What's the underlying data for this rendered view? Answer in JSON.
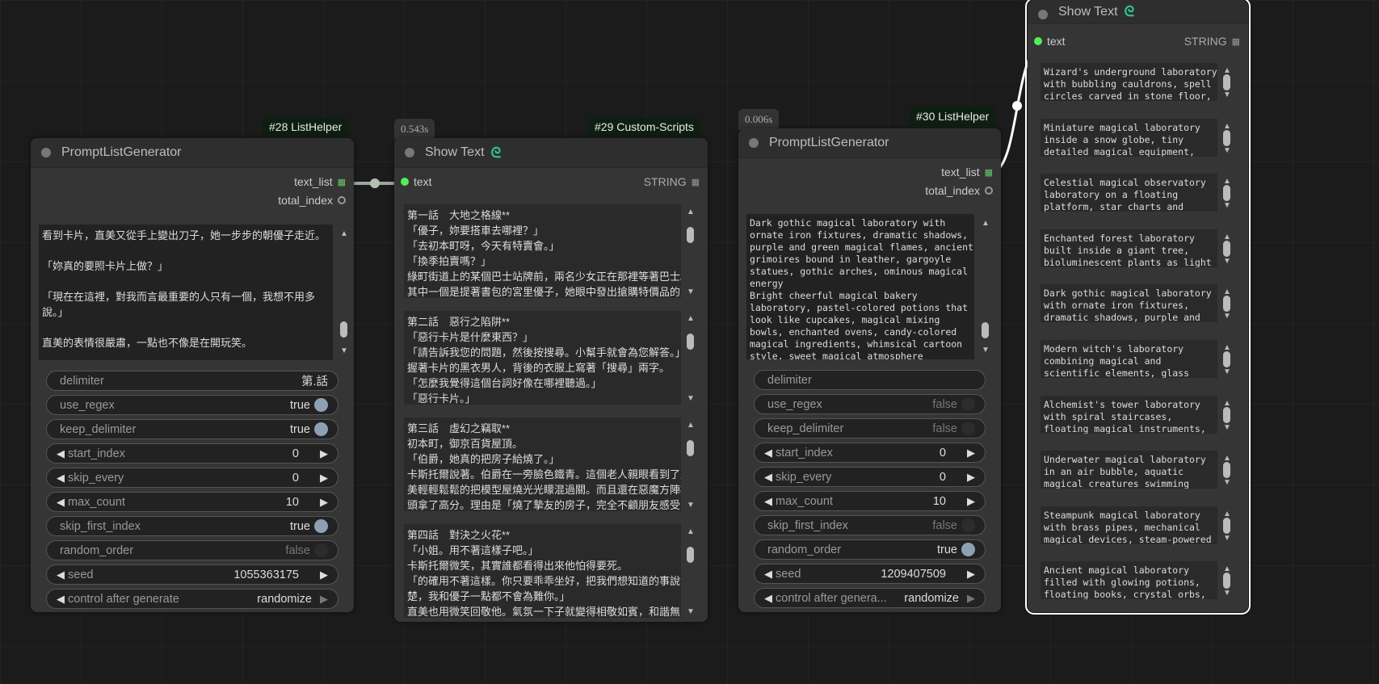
{
  "colors": {
    "accent_green": "#55e055",
    "badge_bg": "#0e1f12",
    "node_bg": "#353535"
  },
  "nodes": [
    {
      "id": "28",
      "badge": "#28 ListHelper",
      "title": "PromptListGenerator",
      "outputs": [
        {
          "name": "text_list",
          "type": "list"
        },
        {
          "name": "total_index",
          "type": "int"
        }
      ],
      "textarea": "看到卡片，直美又從手上變出刀子，她一步步的朝優子走近。\n\n「妳真的要照卡片上做？」\n\n「現在在這裡，對我而言最重要的人只有一個，我想不用多\n說。」\n\n直美的表情很嚴肅，一點也不像是在開玩笑。\n\n「沒有別的辦法了嗎？」",
      "widgets": [
        {
          "kind": "text",
          "label": "delimiter",
          "value": "第.話"
        },
        {
          "kind": "toggle",
          "label": "use_regex",
          "value": "true",
          "on": true
        },
        {
          "kind": "toggle",
          "label": "keep_delimiter",
          "value": "true",
          "on": true
        },
        {
          "kind": "number",
          "label": "start_index",
          "value": "0"
        },
        {
          "kind": "number",
          "label": "skip_every",
          "value": "0"
        },
        {
          "kind": "number",
          "label": "max_count",
          "value": "10"
        },
        {
          "kind": "toggle",
          "label": "skip_first_index",
          "value": "true",
          "on": true
        },
        {
          "kind": "toggle",
          "label": "random_order",
          "value": "false",
          "on": false
        },
        {
          "kind": "number",
          "label": "seed",
          "value": "1055363175"
        },
        {
          "kind": "combo",
          "label": "control after generate",
          "value": "randomize"
        }
      ]
    },
    {
      "id": "29",
      "badge": "#29 Custom-Scripts",
      "time": "0.543s",
      "title": "Show Text",
      "input": "text",
      "input_type": "STRING",
      "items": [
        "第一話　大地之格線**\n「優子，妳要搭車去哪裡？」\n「去初本町呀，今天有特賣會。」\n「換季拍賣嗎？」\n綠町街道上的某個巴士站牌前，兩名少女正在那裡等著巴士。\n其中一個是提著書包的宮里優子，她眼中發出搶購特價品的可",
        "第二話　惡行之陷阱**\n「惡行卡片是什麼東西？」\n「請告訴我您的問題，然後按搜尋。小幫手就會為您解答。」\n握著卡片的黑衣男人，背後的衣服上寫著「搜尋」兩字。\n「怎麼我覺得這個台詞好像在哪裡聽過。」\n「惡行卡片。」",
        "第三話　虛幻之竊取**\n初本町，御京百貨屋頂。\n「伯爵，她真的把房子給燒了。」\n卡斯托爾說著。伯爵在一旁臉色鐵青。這個老人親眼看到了直\n美輕輕鬆鬆的把模型屋燒光光矇混過關。而且還在惡魔方陣裡\n頭拿了高分。理由是「燒了摯友的房子，完全不顧朋友感受的",
        "第四話　對決之火花**\n「小姐。用不著這樣子吧。」\n卡斯托爾微笑，其實誰都看得出來他怕得要死。\n「的確用不著這樣。你只要乖乖坐好，把我們想知道的事說清\n楚，我和優子一點都不會為難你。」\n直美也用微笑回敬他。氣氛一下子就變得相敬如賓，和諧無"
      ]
    },
    {
      "id": "30",
      "badge": "#30 ListHelper",
      "time": "0.006s",
      "title": "PromptListGenerator",
      "outputs": [
        {
          "name": "text_list",
          "type": "list"
        },
        {
          "name": "total_index",
          "type": "int"
        }
      ],
      "textarea": "Dark gothic magical laboratory with\nornate iron fixtures, dramatic shadows,\npurple and green magical flames, ancient\ngrimoires bound in leather, gargoyle\nstatues, gothic arches, ominous magical\nenergy\nBright cheerful magical bakery\nlaboratory, pastel-colored potions that\nlook like cupcakes, magical mixing\nbowls, enchanted ovens, candy-colored\nmagical ingredients, whimsical cartoon\nstyle, sweet magical atmosphere",
      "widgets": [
        {
          "kind": "text",
          "label": "delimiter",
          "value": ""
        },
        {
          "kind": "toggle",
          "label": "use_regex",
          "value": "false",
          "on": false
        },
        {
          "kind": "toggle",
          "label": "keep_delimiter",
          "value": "false",
          "on": false
        },
        {
          "kind": "number",
          "label": "start_index",
          "value": "0"
        },
        {
          "kind": "number",
          "label": "skip_every",
          "value": "0"
        },
        {
          "kind": "number",
          "label": "max_count",
          "value": "10"
        },
        {
          "kind": "toggle",
          "label": "skip_first_index",
          "value": "false",
          "on": false
        },
        {
          "kind": "toggle",
          "label": "random_order",
          "value": "true",
          "on": true
        },
        {
          "kind": "number",
          "label": "seed",
          "value": "1209407509"
        },
        {
          "kind": "combo",
          "label": "control after genera...",
          "value": "randomize"
        }
      ]
    },
    {
      "id": "show2",
      "title": "Show Text",
      "input": "text",
      "input_type": "STRING",
      "items": [
        "Wizard's underground laboratory\nwith bubbling cauldrons, spell\ncircles carved in stone floor,",
        "Miniature magical laboratory\ninside a snow globe, tiny\ndetailed magical equipment,",
        "Celestial magical observatory\nlaboratory on a floating\nplatform, star charts and",
        "Enchanted forest laboratory\nbuilt inside a giant tree,\nbioluminescent plants as light",
        "Dark gothic magical laboratory\nwith ornate iron fixtures,\ndramatic shadows, purple and",
        "Modern witch's laboratory\ncombining magical and\nscientific elements, glass",
        "Alchemist's tower laboratory\nwith spiral staircases,\nfloating magical instruments,",
        "Underwater magical laboratory\nin an air bubble, aquatic\nmagical creatures swimming",
        "Steampunk magical laboratory\nwith brass pipes, mechanical\nmagical devices, steam-powered",
        "Ancient magical laboratory\nfilled with glowing potions,\nfloating books, crystal orbs,"
      ]
    }
  ]
}
